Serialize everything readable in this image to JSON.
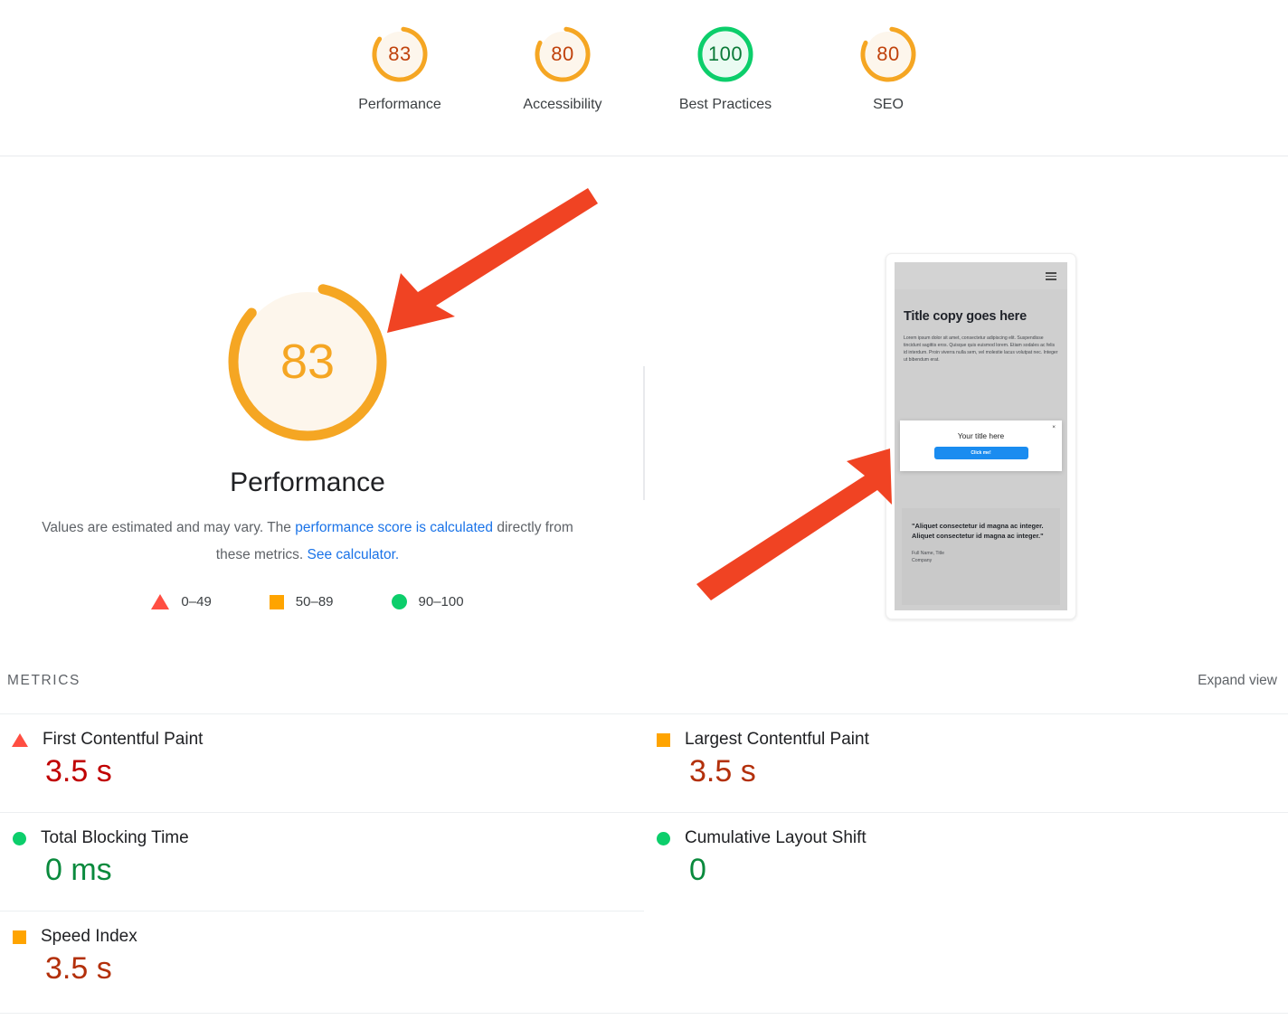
{
  "header": {
    "scores": [
      {
        "value": "83",
        "label": "Performance",
        "color": "#F5A623",
        "track": "#FDF6EC",
        "pct": 83,
        "state": "average"
      },
      {
        "value": "80",
        "label": "Accessibility",
        "color": "#F5A623",
        "track": "#FDF6EC",
        "pct": 80,
        "state": "average"
      },
      {
        "value": "100",
        "label": "Best Practices",
        "color": "#0CCE6B",
        "track": "#EAFBF2",
        "pct": 100,
        "state": "pass"
      },
      {
        "value": "80",
        "label": "SEO",
        "color": "#F5A623",
        "track": "#FDF6EC",
        "pct": 80,
        "state": "average"
      }
    ]
  },
  "gauge": {
    "value": "83",
    "pct": 83,
    "title": "Performance",
    "description_part1": "Values are estimated and may vary. The ",
    "link1": "performance score is calculated",
    "description_part2": " directly from these metrics. ",
    "link2": "See calculator.",
    "legend": [
      {
        "icon": "triangle-icon",
        "label": "0–49",
        "color": "#FF4E42"
      },
      {
        "icon": "square-icon",
        "label": "50–89",
        "color": "#FFA400"
      },
      {
        "icon": "circle-icon",
        "label": "90–100",
        "color": "#0CCE6B"
      }
    ]
  },
  "thumbnail": {
    "hero_title": "Title copy goes here",
    "hero_body": "Lorem ipsum dolor sit amet, consectetur adipiscing elit. Suspendisse tincidunt sagittis eros. Quisque quis euismod lorem. Etiam sodales ac felis id interdum. Proin viverra nulla sem, vel molestie lacus volutpat nec. Integer ut bibendum erat.",
    "modal_title": "Your title here",
    "modal_button": "Click me!",
    "modal_close": "×",
    "quote": "\"Aliquet consectetur id magna ac integer. Aliquet consectetur id magna ac integer.\"",
    "attrib_line1": "Full Name, Title",
    "attrib_line2": "Company"
  },
  "metrics": {
    "section_label": "METRICS",
    "expand_label": "Expand view",
    "left": [
      {
        "icon": "triangle-icon",
        "name": "First Contentful Paint",
        "value": "3.5 s",
        "value_color": "#C00000",
        "icon_kind": "tri"
      },
      {
        "icon": "circle-icon",
        "name": "Total Blocking Time",
        "value": "0 ms",
        "value_color": "#0A8A3D",
        "icon_kind": "cir"
      },
      {
        "icon": "square-icon",
        "name": "Speed Index",
        "value": "3.5 s",
        "value_color": "#B3300B",
        "icon_kind": "sq"
      }
    ],
    "right": [
      {
        "icon": "square-icon",
        "name": "Largest Contentful Paint",
        "value": "3.5 s",
        "value_color": "#B3300B",
        "icon_kind": "sq"
      },
      {
        "icon": "circle-icon",
        "name": "Cumulative Layout Shift",
        "value": "0",
        "value_color": "#0A8A3D",
        "icon_kind": "cir"
      }
    ]
  },
  "annotations": {
    "arrow1": "red-arrow-pointing-to-performance-gauge",
    "arrow2": "red-arrow-pointing-to-modal-popup",
    "color": "#F04323"
  }
}
